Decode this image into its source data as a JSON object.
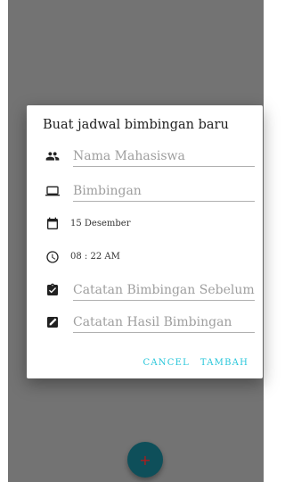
{
  "dialog": {
    "title": "Buat jadwal bimbingan baru",
    "fields": {
      "student_name_placeholder": "Nama Mahasiswa",
      "guidance_placeholder": "Bimbingan",
      "date_value": "15 Desember",
      "time_value": "08 : 22 AM",
      "previous_notes_placeholder": "Catatan Bimbingan Sebelumnya",
      "result_notes_placeholder": "Catatan Hasil Bimbingan"
    },
    "actions": {
      "cancel_label": "CANCEL",
      "add_label": "TAMBAH"
    }
  },
  "fab": {
    "label": "+"
  },
  "icons": {
    "people": "people-icon",
    "laptop": "laptop-icon",
    "calendar": "calendar-icon",
    "clock": "clock-icon",
    "clipboard": "clipboard-icon",
    "note": "edit-note-icon",
    "add": "add-icon"
  },
  "colors": {
    "accent": "#26c6da",
    "overlay": "#737373",
    "fab": "#0e4f5a",
    "fab_glyph": "#b01b1b"
  }
}
